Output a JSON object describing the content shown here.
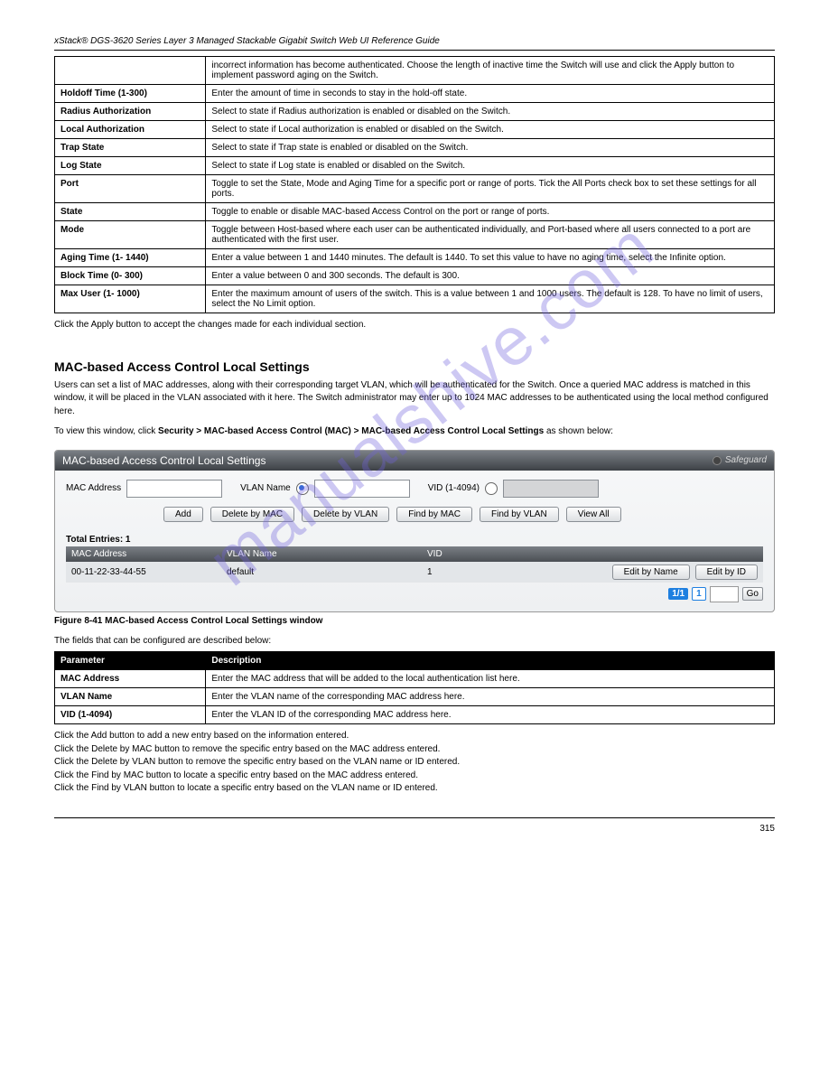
{
  "watermark": "manualshive.com",
  "header": {
    "left": "xStack® DGS-3620 Series Layer 3 Managed Stackable Gigabit Switch Web UI Reference Guide"
  },
  "table1": {
    "rows": [
      {
        "c1": "",
        "c2": "incorrect information has become authenticated. Choose the length of inactive time the Switch will use and click the Apply button to implement password aging on the Switch."
      },
      {
        "c1": "Holdoff Time (1-300)",
        "c2": "Enter the amount of time in seconds to stay in the hold-off state."
      },
      {
        "c1": "Radius Authorization",
        "c2": "Select to state if Radius authorization is enabled or disabled on the Switch."
      },
      {
        "c1": "Local Authorization",
        "c2": "Select to state if Local authorization is enabled or disabled on the Switch."
      },
      {
        "c1": "Trap State",
        "c2": "Select to state if Trap state is enabled or disabled on the Switch."
      },
      {
        "c1": "Log State",
        "c2": "Select to state if Log state is enabled or disabled on the Switch."
      },
      {
        "c1": "Port",
        "c2": "Toggle to set the State, Mode and Aging Time for a specific port or range of ports. Tick the All Ports check box to set these settings for all ports."
      },
      {
        "c1": "State",
        "c2": "Toggle to enable or disable MAC-based Access Control on the port or range of ports."
      },
      {
        "c1": "Mode",
        "c2": "Toggle between Host-based where each user can be authenticated individually, and Port-based where all users connected to a port are authenticated with the first user."
      },
      {
        "c1": "Aging Time (1- 1440)",
        "c2": "Enter a value between 1 and 1440 minutes. The default is 1440. To set this value to have no aging time, select the Infinite option."
      },
      {
        "c1": "Block Time (0- 300)",
        "c2": "Enter a value between 0 and 300 seconds. The default is 300."
      },
      {
        "c1": "Max User (1- 1000)",
        "c2": "Enter the maximum amount of users of the switch. This is a value between 1 and 1000 users. The default is 128. To have no limit of users, select the No Limit option."
      }
    ],
    "note": "Click the Apply button to accept the changes made for each individual section."
  },
  "section2": {
    "title": "MAC-based Access Control Local Settings",
    "p1": "Users can set a list of MAC addresses, along with their corresponding target VLAN, which will be authenticated for the Switch. Once a queried MAC address is matched in this window, it will be placed in the VLAN associated with it here. The Switch administrator may enter up to 1024 MAC addresses to be authenticated using the local method configured here.",
    "p2_pre": "To view this window, click ",
    "p2_b1": "Security > MAC-based Access Control (MAC) > MAC-based Access Control Local Settings",
    "p2_post": " as shown below:"
  },
  "panel": {
    "title": "MAC-based Access Control Local Settings",
    "safeguard": "Safeguard",
    "labels": {
      "mac": "MAC Address",
      "vlan_name": "VLAN Name",
      "vid": "VID (1-4094)"
    },
    "buttons": {
      "add": "Add",
      "del_mac": "Delete by MAC",
      "del_vlan": "Delete by VLAN",
      "find_mac": "Find by MAC",
      "find_vlan": "Find by VLAN",
      "view_all": "View All",
      "edit_name": "Edit by Name",
      "edit_id": "Edit by ID",
      "go": "Go"
    },
    "entries_label": "Total Entries: 1",
    "grid_headers": {
      "mac": "MAC Address",
      "vlan": "VLAN Name",
      "vid": "VID"
    },
    "row": {
      "mac": "00-11-22-33-44-55",
      "vlan": "default",
      "vid": "1"
    },
    "pager": {
      "p1": "1/1",
      "p2": "1"
    }
  },
  "fig_caption": "Figure 8-41 MAC-based Access Control Local Settings window",
  "table2": {
    "intro": "The fields that can be configured are described below:",
    "headers": {
      "c1": "Parameter",
      "c2": "Description"
    },
    "rows": [
      {
        "c1": "MAC Address",
        "c2": "Enter the MAC address that will be added to the local authentication list here."
      },
      {
        "c1": "VLAN Name",
        "c2": "Enter the VLAN name of the corresponding MAC address here."
      },
      {
        "c1": "VID (1-4094)",
        "c2": "Enter the VLAN ID of the corresponding MAC address here."
      }
    ]
  },
  "post_buttons": [
    "Click the Add button to add a new entry based on the information entered.",
    "Click the Delete by MAC button to remove the specific entry based on the MAC address entered.",
    "Click the Delete by VLAN button to remove the specific entry based on the VLAN name or ID entered.",
    "Click the Find by MAC button to locate a specific entry based on the MAC address entered.",
    "Click the Find by VLAN button to locate a specific entry based on the VLAN name or ID entered."
  ],
  "page_no": "315"
}
